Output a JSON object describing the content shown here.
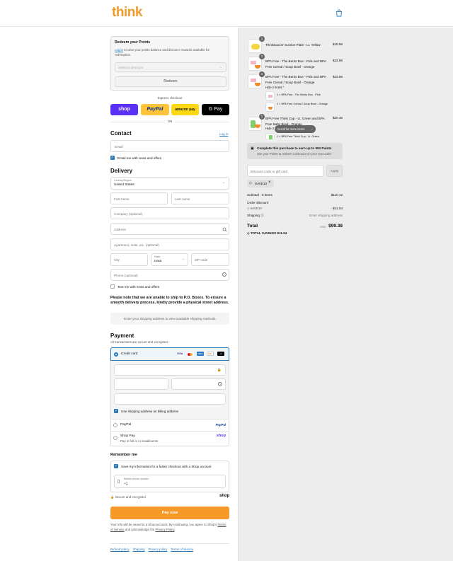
{
  "brand": {
    "logo": "think",
    "accent": "#f39b2a",
    "link": "#2a7aba"
  },
  "points": {
    "title": "Redeem your Points",
    "login_link": "Log in",
    "body": " to view your points balance and discover rewards available for redemption.",
    "select_placeholder": "Select a discount",
    "button": "Redeem"
  },
  "express": {
    "label": "Express checkout",
    "shop": "shop",
    "paypal": "PayPal",
    "amazon": "amazon pay",
    "gpay": "G Pay",
    "or": "OR"
  },
  "contact": {
    "title": "Contact",
    "login": "Log in",
    "email_placeholder": "Email",
    "news_label": "Email me with news and offers"
  },
  "delivery": {
    "title": "Delivery",
    "country_label": "Country/Region",
    "country_value": "United States",
    "first": "First name",
    "last": "Last name",
    "company": "Company (optional)",
    "address": "Address",
    "apt": "Apartment, suite, etc. (optional)",
    "city": "City",
    "state_label": "State",
    "state_value": "Iowa",
    "zip": "ZIP code",
    "phone": "Phone (optional)",
    "text_label": "Text me with news and offers",
    "note": "Please note that we are unable to ship to P.O. Boxes. To ensure a smooth delivery process, kindly provide a physical street address.",
    "shipping_msg": "Enter your shipping address to view available shipping methods."
  },
  "payment": {
    "title": "Payment",
    "subtitle": "All transactions are secure and encrypted.",
    "credit_card": "Credit card",
    "card_brands": [
      "VISA",
      "MC",
      "AMEX",
      "DISC",
      "+4"
    ],
    "billing_label": "Use shipping address as billing address",
    "paypal": "PayPal",
    "paypal_logo": "PayPal",
    "shoppay": "Shop Pay",
    "shoppay_sub": "Pay in full or in installments",
    "shoppay_logo": "shop"
  },
  "remember": {
    "title": "Remember me",
    "save_label": "Save my information for a faster checkout with a Shop account",
    "mobile_label": "Mobile phone number",
    "mobile_value": "+1",
    "secure": "Secure and encrypted",
    "shop_logo": "shop"
  },
  "paynow": "Pay now",
  "legal": {
    "text": "Your info will be saved to a Shop account. By continuing, you agree to Shop's ",
    "terms": "Terms of Service",
    "and": " and acknowledge the ",
    "privacy": "Privacy Policy",
    "end": "."
  },
  "footer": [
    "Refund policy",
    "Shipping",
    "Privacy policy",
    "Terms of service"
  ],
  "cart": {
    "items": [
      {
        "qty": "1",
        "name": "ThinkSaucer Suction Plate - Lt. Yellow",
        "price": "$19.99"
      },
      {
        "qty": "1",
        "name": "BPA Free - The Bento Box - Pink and BPA Free Cereal / Soup Bowl - Orange",
        "price": "$23.98"
      },
      {
        "qty": "1",
        "name": "BPA Free - The Bento Box - Pink and BPA Free Cereal / Soup Bowl - Orange",
        "price": "$23.98",
        "toggle": "Hide 2 items ^",
        "sub": [
          "1 × BPA Free - The Bento Box - Pink",
          "1 × BPA Free Cereal / Soup Bowl - Orange"
        ]
      },
      {
        "qty": "1",
        "name": "BPA Free Think Cup - Lt. Green and BPA Free Baby Bowl - Orange",
        "price": "$20.48",
        "toggle": "Hide 2",
        "sub_partial": "1 × BPA Free Think Cup - Lt. Green"
      }
    ],
    "scroll_pill": "Scroll for more items",
    "earn_title": "Complete this purchase to earn up to 993 Points",
    "earn_sub": "Use your Points to redeem a discount on your next order",
    "discount_placeholder": "Discount code or gift card",
    "apply": "Apply",
    "code": "SAVE10",
    "subtotal_label": "Subtotal · 5 items",
    "subtotal": "$110.42",
    "order_discount": "Order discount",
    "discount_code": "SAVE10",
    "discount_amount": "- $11.04",
    "shipping_label": "Shipping",
    "shipping_value": "Enter shipping address",
    "total_label": "Total",
    "currency": "USD",
    "total": "$99.38",
    "savings_label": "TOTAL SAVINGS",
    "savings": "$11.04"
  }
}
